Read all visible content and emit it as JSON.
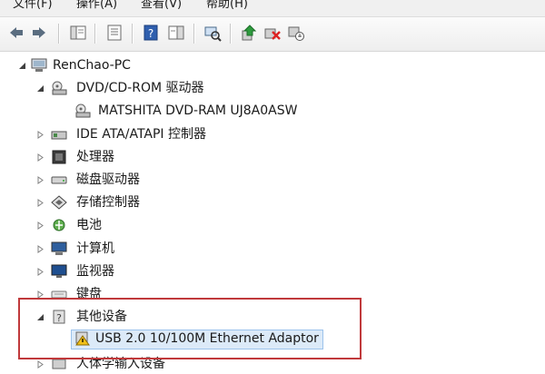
{
  "menu": {
    "file": "文件(F)",
    "action": "操作(A)",
    "view": "查看(V)",
    "help": "帮助(H)"
  },
  "toolbar": {
    "buttons": [
      "back-icon",
      "forward-icon",
      "show-hide-tree-icon",
      "properties-icon",
      "help-icon",
      "details-pane-icon",
      "scan-hardware-icon",
      "update-driver-icon",
      "uninstall-icon",
      "disable-icon"
    ]
  },
  "tree": {
    "root": "RenChao-PC",
    "dvd_group": "DVD/CD-ROM 驱动器",
    "dvd_device": "MATSHITA DVD-RAM UJ8A0ASW",
    "ide": "IDE ATA/ATAPI 控制器",
    "cpu": "处理器",
    "disk": "磁盘驱动器",
    "storage": "存储控制器",
    "battery": "电池",
    "computer": "计算机",
    "monitor": "监视器",
    "keyboard": "键盘",
    "other": "其他设备",
    "other_device": "USB 2.0 10/100M Ethernet Adaptor",
    "hid": "人体学输入设备"
  },
  "colors": {
    "highlight_border": "#c0393b",
    "selection_fill": "#dceaf8",
    "selection_border": "#9cc3ec"
  }
}
